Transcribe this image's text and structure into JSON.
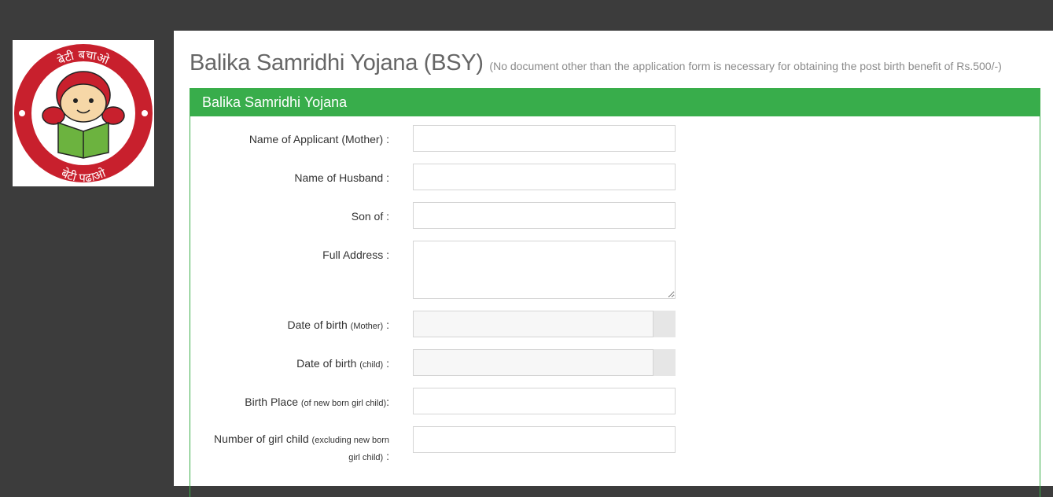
{
  "logo": {
    "top_text": "बेटी बचाओ",
    "bottom_text": "बेटी पढ़ाओ",
    "colors": {
      "ring": "#c8202d",
      "book": "#6cb33f",
      "hair": "#c8202d"
    }
  },
  "page": {
    "title": "Balika Samridhi Yojana (BSY)",
    "note": "(No document other than the application form is necessary for obtaining the post birth benefit of Rs.500/-)"
  },
  "panel": {
    "heading": "Balika Samridhi Yojana",
    "accent_color": "#38ad4b"
  },
  "form": {
    "mother_name": {
      "label": "Name of Applicant (Mother) :",
      "value": ""
    },
    "husband_name": {
      "label": "Name of Husband :",
      "value": ""
    },
    "son_of": {
      "label": "Son of :",
      "value": ""
    },
    "address": {
      "label": "Full Address :",
      "value": ""
    },
    "dob_mother": {
      "label": "Date of birth",
      "sub": "(Mother)",
      "suffix": " :",
      "value": ""
    },
    "dob_child": {
      "label": "Date of birth",
      "sub": "(child)",
      "suffix": " :",
      "value": ""
    },
    "birth_place": {
      "label": "Birth Place",
      "sub": "(of new born girl child)",
      "suffix": ":",
      "value": ""
    },
    "girl_count": {
      "label": "Number of girl child",
      "sub": "(excluding new born girl child)",
      "suffix": " :",
      "value": ""
    }
  }
}
